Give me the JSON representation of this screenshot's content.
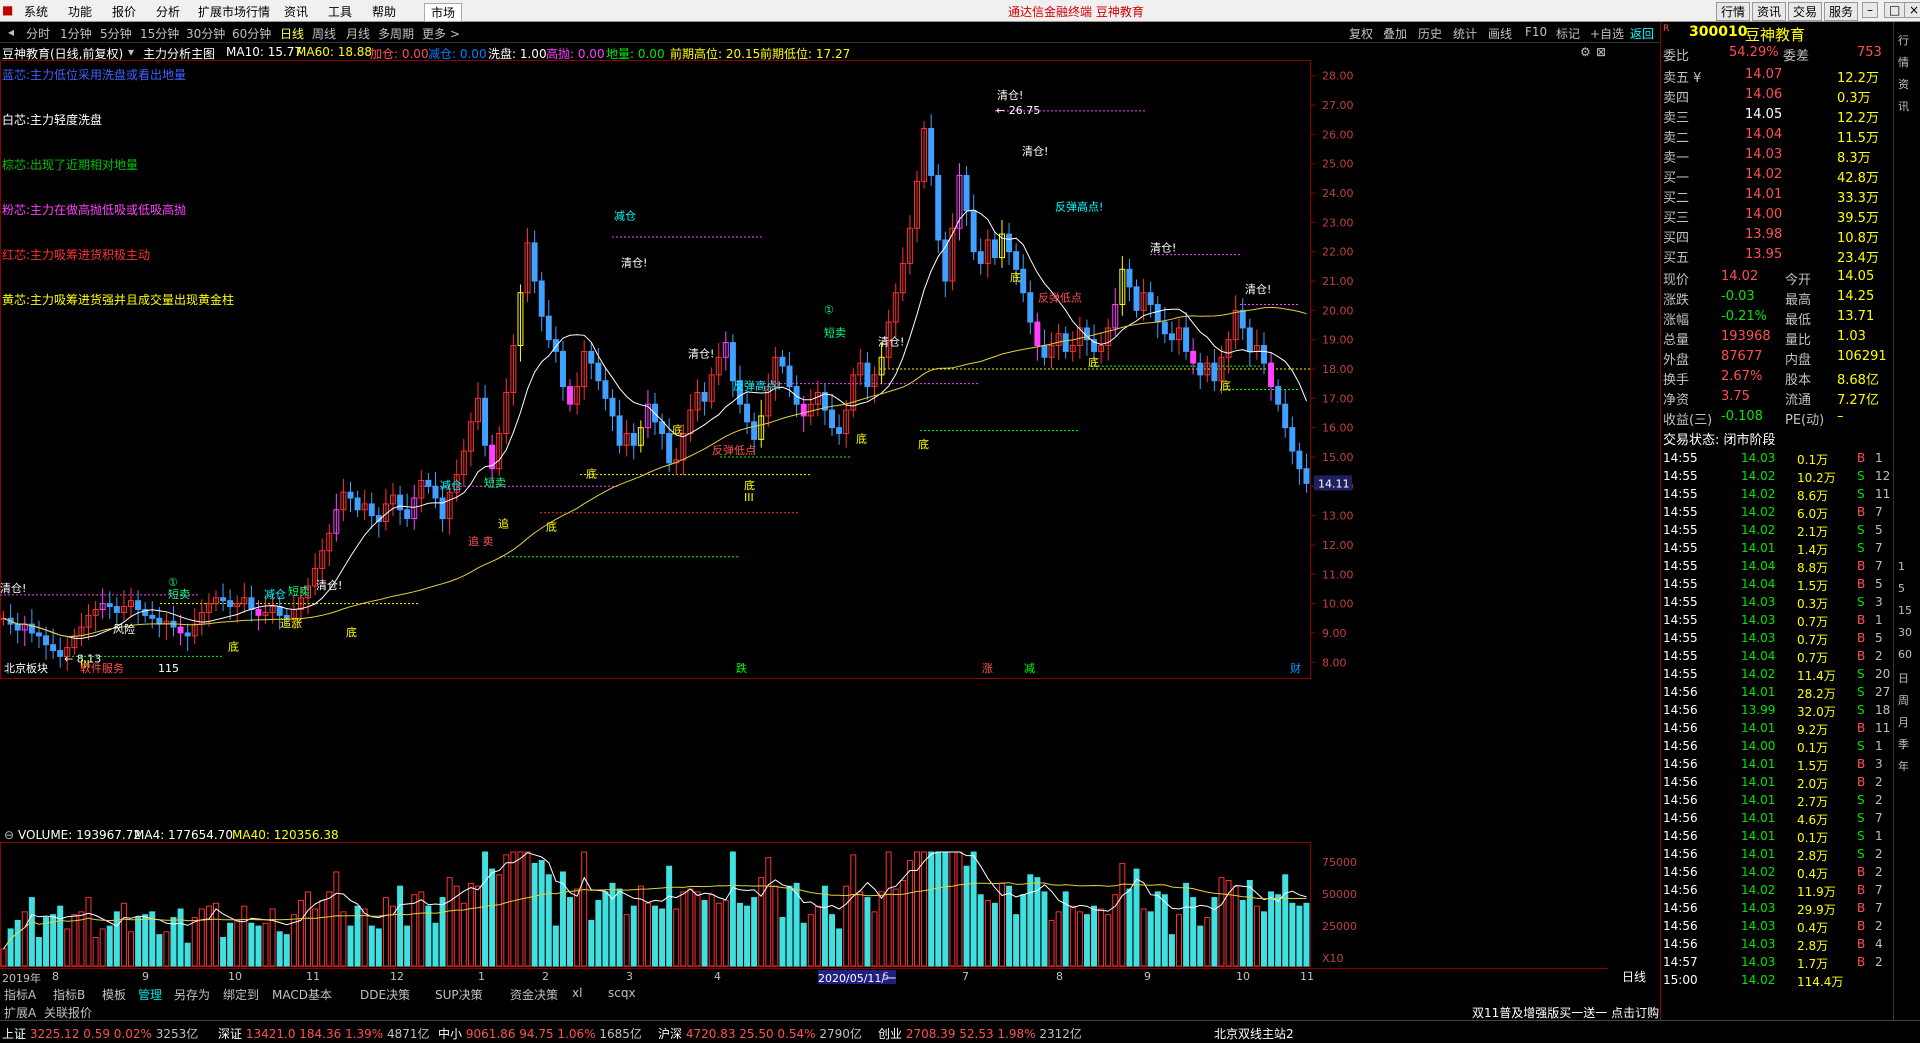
{
  "menubar": {
    "items": [
      "系统",
      "功能",
      "报价",
      "分析",
      "扩展市场行情",
      "资讯",
      "工具",
      "帮助",
      "市场"
    ],
    "center_text": "通达信金融终端  豆神教育",
    "right_buttons": [
      "行情",
      "资讯",
      "交易",
      "服务"
    ]
  },
  "toolbar": {
    "periods": [
      "分时",
      "1分钟",
      "5分钟",
      "15分钟",
      "30分钟",
      "60分钟",
      "日线",
      "周线",
      "月线",
      "多周期",
      "更多 >"
    ],
    "selected": "日线",
    "right": [
      "复权",
      "叠加",
      "历史",
      "统计",
      "画线",
      "F10",
      "标记",
      "+自选",
      "返回"
    ]
  },
  "indicator_bar": {
    "stock": "豆神教育(日线,前复权)",
    "template": "主力分析主图",
    "items": [
      {
        "label": "MA10: 15.77",
        "color": "#ffffff"
      },
      {
        "label": "MA60: 18.88",
        "color": "#ffff00"
      },
      {
        "label": "加仓: 0.00",
        "color": "#ff5050"
      },
      {
        "label": "减仓: 0.00",
        "color": "#0080ff"
      },
      {
        "label": "洗盘: 1.00",
        "color": "#ffffff"
      },
      {
        "label": "高抛: 0.00",
        "color": "#ff40ff"
      },
      {
        "label": "地量: 0.00",
        "color": "#00e600"
      },
      {
        "label": "前期高位: 20.15",
        "color": "#ffff00"
      },
      {
        "label": "前期低位: 17.27",
        "color": "#ffff00"
      }
    ]
  },
  "legend": [
    {
      "text": "蓝芯:主力低位采用洗盘或看出地量",
      "color": "#4060ff"
    },
    {
      "text": "白芯:主力轻度洗盘",
      "color": "#ffffff"
    },
    {
      "text": "棕芯:出现了近期相对地量",
      "color": "#00c000"
    },
    {
      "text": "粉芯:主力在做高抛低吸或低吸高抛",
      "color": "#ff40ff"
    },
    {
      "text": "红芯:主力吸筹进货积极主动",
      "color": "#ff3030"
    },
    {
      "text": "黄芯:主力吸筹进货强并且成交量出现黄金柱",
      "color": "#ffff00"
    }
  ],
  "price_axis": [
    "28.00",
    "27.00",
    "26.00",
    "25.00",
    "24.00",
    "23.00",
    "22.00",
    "21.00",
    "20.00",
    "19.00",
    "18.00",
    "17.00",
    "16.00",
    "15.00",
    "14.00",
    "13.00",
    "12.00",
    "11.00",
    "10.00",
    "9.00",
    "8.00"
  ],
  "last_price_tag": "14.11",
  "annotations": [
    {
      "text": "清仓!",
      "color": "#ffffff",
      "x": 0,
      "price": 10.4
    },
    {
      "text": "短卖",
      "color": "#00ff80",
      "x": 168,
      "price": 10.2
    },
    {
      "text": "①",
      "color": "#00ff80",
      "x": 168,
      "price": 10.6
    },
    {
      "text": "风险",
      "color": "#ffffff",
      "x": 113,
      "price": 9.0
    },
    {
      "text": "← 8.13",
      "color": "#ffffff",
      "x": 64,
      "price": 8.0
    },
    {
      "text": "III",
      "color": "#ffff00",
      "x": 80,
      "price": 7.8
    },
    {
      "text": "底",
      "color": "#ffff00",
      "x": 228,
      "price": 8.4
    },
    {
      "text": "减仓",
      "color": "#00ffff",
      "x": 264,
      "price": 10.2
    },
    {
      "text": "短卖",
      "color": "#00ff80",
      "x": 288,
      "price": 10.3
    },
    {
      "text": "清仓!",
      "color": "#ffffff",
      "x": 316,
      "price": 10.5
    },
    {
      "text": "追涨",
      "color": "#ffff00",
      "x": 280,
      "price": 9.2
    },
    {
      "text": "底",
      "color": "#ffff00",
      "x": 346,
      "price": 8.9
    },
    {
      "text": "减仓",
      "color": "#00ffff",
      "x": 440,
      "price": 13.9
    },
    {
      "text": "短卖",
      "color": "#00ff80",
      "x": 484,
      "price": 14.0
    },
    {
      "text": "追",
      "color": "#ffff00",
      "x": 498,
      "price": 12.6
    },
    {
      "text": "追 卖",
      "color": "#ff5050",
      "x": 468,
      "price": 12.0
    },
    {
      "text": "底",
      "color": "#ffff00",
      "x": 546,
      "price": 12.5
    },
    {
      "text": "底",
      "color": "#ffff00",
      "x": 586,
      "price": 14.3
    },
    {
      "text": "减仓",
      "color": "#00ffff",
      "x": 614,
      "price": 23.1
    },
    {
      "text": "清仓!",
      "color": "#ffffff",
      "x": 621,
      "price": 21.5
    },
    {
      "text": "清仓!",
      "color": "#ffffff",
      "x": 688,
      "price": 18.4
    },
    {
      "text": "底",
      "color": "#ffff00",
      "x": 672,
      "price": 15.8
    },
    {
      "text": "反弹高点!",
      "color": "#00ffff",
      "x": 733,
      "price": 17.3
    },
    {
      "text": "反弹低点",
      "color": "#ff5050",
      "x": 712,
      "price": 15.1
    },
    {
      "text": "底",
      "color": "#ffff00",
      "x": 744,
      "price": 13.9
    },
    {
      "text": "III",
      "color": "#ffff00",
      "x": 744,
      "price": 13.5
    },
    {
      "text": "①",
      "color": "#00ff80",
      "x": 824,
      "price": 19.9
    },
    {
      "text": "短卖",
      "color": "#00ff80",
      "x": 824,
      "price": 19.1
    },
    {
      "text": "清仓!",
      "color": "#ffffff",
      "x": 878,
      "price": 18.8
    },
    {
      "text": "底",
      "color": "#ffff00",
      "x": 856,
      "price": 15.5
    },
    {
      "text": "底",
      "color": "#ffff00",
      "x": 918,
      "price": 15.3
    },
    {
      "text": "清仓!",
      "color": "#ffffff",
      "x": 997,
      "price": 27.2
    },
    {
      "text": "← 26.75",
      "color": "#ffffff",
      "x": 996,
      "price": 26.7
    },
    {
      "text": "清仓!",
      "color": "#ffffff",
      "x": 1022,
      "price": 25.3
    },
    {
      "text": "反弹高点!",
      "color": "#00ffff",
      "x": 1055,
      "price": 23.4
    },
    {
      "text": "底",
      "color": "#ffff00",
      "x": 1010,
      "price": 21.0
    },
    {
      "text": "反弹低点",
      "color": "#ff5050",
      "x": 1038,
      "price": 20.3
    },
    {
      "text": "底",
      "color": "#ffff00",
      "x": 1088,
      "price": 18.1
    },
    {
      "text": "清仓!",
      "color": "#ffffff",
      "x": 1150,
      "price": 22.0
    },
    {
      "text": "清仓!",
      "color": "#ffffff",
      "x": 1245,
      "price": 20.6
    },
    {
      "text": "底",
      "color": "#ffff00",
      "x": 1220,
      "price": 17.3
    }
  ],
  "bottom_chart_labels": [
    {
      "text": "北京板块",
      "color": "#ffffff",
      "x": 4
    },
    {
      "text": "软件服务",
      "color": "#ff5050",
      "x": 80
    },
    {
      "text": "115",
      "color": "#ffffff",
      "x": 158
    },
    {
      "text": "跌",
      "color": "#00ff00",
      "x": 736
    },
    {
      "text": "涨",
      "color": "#ff5050",
      "x": 982
    },
    {
      "text": "减",
      "color": "#00ff00",
      "x": 1024
    },
    {
      "text": "财",
      "color": "#00a0ff",
      "x": 1290
    }
  ],
  "volume_bar": {
    "label": "VOLUME: 193967.72",
    "ma4": "MA4: 177654.70",
    "ma40": "MA40: 120356.38",
    "axis": [
      "75000",
      "50000",
      "25000",
      "X10"
    ]
  },
  "x_axis": {
    "labels": [
      {
        "text": "2019年",
        "x": 2
      },
      {
        "text": "8",
        "x": 52
      },
      {
        "text": "9",
        "x": 142
      },
      {
        "text": "10",
        "x": 228
      },
      {
        "text": "11",
        "x": 306
      },
      {
        "text": "12",
        "x": 390
      },
      {
        "text": "1",
        "x": 478
      },
      {
        "text": "2",
        "x": 542
      },
      {
        "text": "3",
        "x": 626
      },
      {
        "text": "4",
        "x": 714
      },
      {
        "text": "2020/05/11/一",
        "x": 818
      },
      {
        "text": "6",
        "x": 882
      },
      {
        "text": "7",
        "x": 962
      },
      {
        "text": "8",
        "x": 1056
      },
      {
        "text": "9",
        "x": 1144
      },
      {
        "text": "10",
        "x": 1236
      },
      {
        "text": "11",
        "x": 1300
      }
    ],
    "period": "日线"
  },
  "bottom_tabs": [
    "指标A",
    "指标B",
    "模板",
    "管理",
    "另存为",
    "绑定到",
    "MACD基本",
    "DDE决策",
    "SUP决策",
    "资金决策",
    "xl",
    "scqx"
  ],
  "status_row1": {
    "left": [
      "扩展A",
      "关联报价"
    ],
    "right": "双11普及增强版买一送一 点击订购"
  },
  "status_row2": [
    {
      "name": "上证",
      "value": "3225.12",
      "change": "0.59",
      "pct": "0.02%",
      "amount": "3253亿"
    },
    {
      "name": "深证",
      "value": "13421.0",
      "change": "184.36",
      "pct": "1.39%",
      "amount": "4871亿"
    },
    {
      "name": "中小",
      "value": "9061.86",
      "change": "94.75",
      "pct": "1.06%",
      "amount": "1685亿"
    },
    {
      "name": "沪深",
      "value": "4720.83",
      "change": "25.50",
      "pct": "0.54%",
      "amount": "2790亿"
    },
    {
      "name": "创业",
      "value": "2708.39",
      "change": "52.53",
      "pct": "1.98%",
      "amount": "2312亿"
    }
  ],
  "status_right": "北京双线主站2",
  "right_panel": {
    "code": "300010",
    "name": "豆神教育",
    "weibi": {
      "label": "委比",
      "value": "54.29%",
      "label2": "委差",
      "value2": "753"
    },
    "asks": [
      {
        "label": "卖五",
        "flag": "¥",
        "price": "14.07",
        "vol": "12.2万"
      },
      {
        "label": "卖四",
        "flag": "",
        "price": "14.06",
        "vol": "0.3万"
      },
      {
        "label": "卖三",
        "flag": "",
        "price": "14.05",
        "vol": "12.2万"
      },
      {
        "label": "卖二",
        "flag": "",
        "price": "14.04",
        "vol": "11.5万"
      },
      {
        "label": "卖一",
        "flag": "",
        "price": "14.03",
        "vol": "8.3万"
      }
    ],
    "bids": [
      {
        "label": "买一",
        "price": "14.02",
        "vol": "42.8万"
      },
      {
        "label": "买二",
        "price": "14.01",
        "vol": "33.3万"
      },
      {
        "label": "买三",
        "price": "14.00",
        "vol": "39.5万"
      },
      {
        "label": "买四",
        "price": "13.98",
        "vol": "10.8万"
      },
      {
        "label": "买五",
        "price": "13.95",
        "vol": "23.4万"
      }
    ],
    "stats": [
      {
        "l1": "现价",
        "v1": "14.02",
        "l2": "今开",
        "v2": "14.05"
      },
      {
        "l1": "涨跌",
        "v1": "-0.03",
        "l2": "最高",
        "v2": "14.25"
      },
      {
        "l1": "涨幅",
        "v1": "-0.21%",
        "l2": "最低",
        "v2": "13.71"
      },
      {
        "l1": "总量",
        "v1": "193968",
        "l2": "量比",
        "v2": "1.03"
      },
      {
        "l1": "外盘",
        "v1": "87677",
        "l2": "内盘",
        "v2": "106291"
      },
      {
        "l1": "换手",
        "v1": "2.67%",
        "l2": "股本",
        "v2": "8.68亿"
      },
      {
        "l1": "净资",
        "v1": "3.75",
        "l2": "流通",
        "v2": "7.27亿"
      },
      {
        "l1": "收益(三)",
        "v1": "-0.108",
        "l2": "PE(动)",
        "v2": "–"
      }
    ],
    "trade_state": "交易状态: 闭市阶段",
    "ticks": [
      [
        "14:55",
        "14.03",
        "0.1万",
        "B",
        "1"
      ],
      [
        "14:55",
        "14.02",
        "10.2万",
        "S",
        "12"
      ],
      [
        "14:55",
        "14.02",
        "8.6万",
        "S",
        "11"
      ],
      [
        "14:55",
        "14.02",
        "6.0万",
        "B",
        "7"
      ],
      [
        "14:55",
        "14.02",
        "2.1万",
        "S",
        "5"
      ],
      [
        "14:55",
        "14.01",
        "1.4万",
        "S",
        "7"
      ],
      [
        "14:55",
        "14.04",
        "8.8万",
        "B",
        "7"
      ],
      [
        "14:55",
        "14.04",
        "1.5万",
        "B",
        "5"
      ],
      [
        "14:55",
        "14.03",
        "0.3万",
        "S",
        "3"
      ],
      [
        "14:55",
        "14.03",
        "0.7万",
        "B",
        "1"
      ],
      [
        "14:55",
        "14.03",
        "0.7万",
        "B",
        "5"
      ],
      [
        "14:55",
        "14.04",
        "0.7万",
        "B",
        "2"
      ],
      [
        "14:55",
        "14.02",
        "11.4万",
        "S",
        "20"
      ],
      [
        "14:56",
        "14.01",
        "28.2万",
        "S",
        "27"
      ],
      [
        "14:56",
        "13.99",
        "32.0万",
        "S",
        "18"
      ],
      [
        "14:56",
        "14.01",
        "9.2万",
        "B",
        "11"
      ],
      [
        "14:56",
        "14.00",
        "0.1万",
        "S",
        "1"
      ],
      [
        "14:56",
        "14.01",
        "1.5万",
        "B",
        "3"
      ],
      [
        "14:56",
        "14.01",
        "2.0万",
        "B",
        "2"
      ],
      [
        "14:56",
        "14.01",
        "2.7万",
        "S",
        "2"
      ],
      [
        "14:56",
        "14.01",
        "4.6万",
        "S",
        "7"
      ],
      [
        "14:56",
        "14.01",
        "0.1万",
        "S",
        "1"
      ],
      [
        "14:56",
        "14.01",
        "2.8万",
        "S",
        "2"
      ],
      [
        "14:56",
        "14.02",
        "0.4万",
        "B",
        "2"
      ],
      [
        "14:56",
        "14.02",
        "11.9万",
        "B",
        "7"
      ],
      [
        "14:56",
        "14.03",
        "29.9万",
        "B",
        "7"
      ],
      [
        "14:56",
        "14.03",
        "0.4万",
        "B",
        "2"
      ],
      [
        "14:56",
        "14.03",
        "2.8万",
        "B",
        "4"
      ],
      [
        "14:57",
        "14.03",
        "1.7万",
        "B",
        "2"
      ],
      [
        "15:00",
        "14.02",
        "114.4万",
        "",
        ""
      ]
    ]
  },
  "side_tools": [
    "行",
    "情",
    "资",
    "讯",
    "1",
    "5",
    "15",
    "30",
    "60",
    "日",
    "周",
    "月",
    "季",
    "年"
  ],
  "chart_data": {
    "type": "candlestick",
    "title": "豆神教育(日线,前复权)",
    "ylim": [
      7.6,
      28.4
    ],
    "closes": [
      9.5,
      9.3,
      9.1,
      9.3,
      9.0,
      8.9,
      8.6,
      8.4,
      8.2,
      8.5,
      8.9,
      9.2,
      9.6,
      9.8,
      10.0,
      9.9,
      9.7,
      9.9,
      10.1,
      9.8,
      9.6,
      9.5,
      9.3,
      9.4,
      9.2,
      9.0,
      8.9,
      9.3,
      9.7,
      10.0,
      10.2,
      10.1,
      9.9,
      10.0,
      10.2,
      9.8,
      9.6,
      9.7,
      9.9,
      9.6,
      9.5,
      9.8,
      10.2,
      10.6,
      11.2,
      11.8,
      12.4,
      13.2,
      13.8,
      13.6,
      13.2,
      13.4,
      13.0,
      12.8,
      13.4,
      13.7,
      13.2,
      12.9,
      13.6,
      14.2,
      14.0,
      13.6,
      12.9,
      13.8,
      14.4,
      15.2,
      16.2,
      17.0,
      15.4,
      14.6,
      15.8,
      17.2,
      18.8,
      20.6,
      22.3,
      21.0,
      19.8,
      19.0,
      18.6,
      17.4,
      16.8,
      17.4,
      18.6,
      18.2,
      17.6,
      17.0,
      16.4,
      15.4,
      15.8,
      15.4,
      16.0,
      16.8,
      16.2,
      15.8,
      14.8,
      14.9,
      15.8,
      16.6,
      17.2,
      16.9,
      17.8,
      18.4,
      18.9,
      17.6,
      16.8,
      16.2,
      15.6,
      16.4,
      17.4,
      18.4,
      18.1,
      17.4,
      16.8,
      16.4,
      16.8,
      17.2,
      16.6,
      16.0,
      15.8,
      16.6,
      17.8,
      18.2,
      17.4,
      17.8,
      18.4,
      19.6,
      20.6,
      21.6,
      22.8,
      24.4,
      26.2,
      24.6,
      22.4,
      21.0,
      22.8,
      24.6,
      23.4,
      22.0,
      21.6,
      22.4,
      21.8,
      22.6,
      22.0,
      21.4,
      20.6,
      19.6,
      18.8,
      18.4,
      18.8,
      19.2,
      18.6,
      18.8,
      19.4,
      19.0,
      18.6,
      18.8,
      19.4,
      20.2,
      21.4,
      20.8,
      20.0,
      20.6,
      20.2,
      19.6,
      19.2,
      19.0,
      19.4,
      18.6,
      18.2,
      17.8,
      18.2,
      17.6,
      18.4,
      19.0,
      20.0,
      19.4,
      18.6,
      18.8,
      18.2,
      17.4,
      16.8,
      16.0,
      15.2,
      14.6,
      14.1
    ]
  }
}
